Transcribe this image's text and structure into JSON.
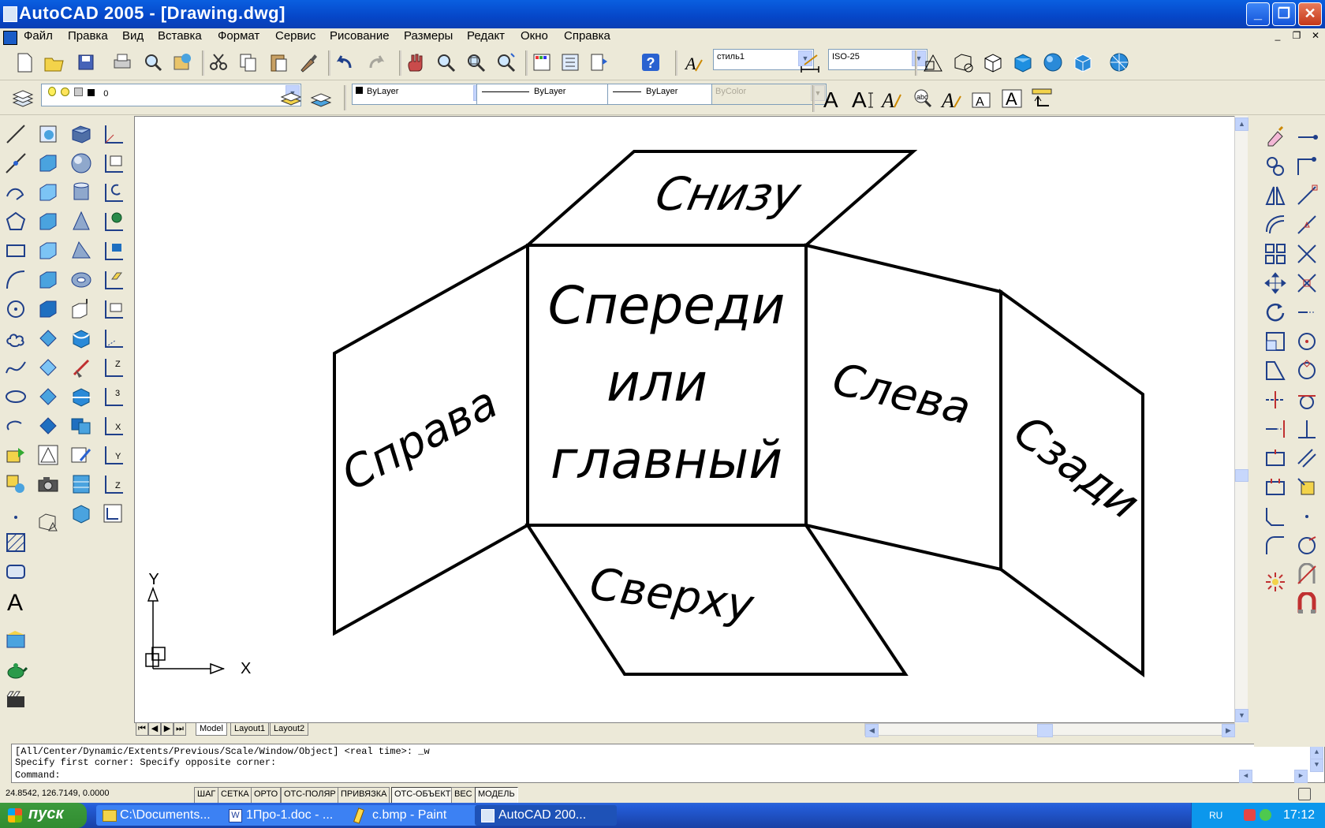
{
  "window": {
    "title": "AutoCAD 2005 - [Drawing.dwg]",
    "minimize": "_",
    "restore": "❐",
    "close": "✕"
  },
  "menu": {
    "items": [
      "Файл",
      "Правка",
      "Вид",
      "Вставка",
      "Формат",
      "Сервис",
      "Рисование",
      "Размеры",
      "Редакт",
      "Окно",
      "Справка"
    ],
    "mdi_min": "_",
    "mdi_restore": "❐",
    "mdi_close": "✕"
  },
  "toolbar": {
    "text_style": "стиль1",
    "dim_style": "ISO-25",
    "layer": "0",
    "color": "ByLayer",
    "linetype": "ByLayer",
    "lineweight": "ByLayer",
    "plotstyle": "ByColor"
  },
  "drawing": {
    "label_bottom": "Снизу",
    "label_front_1": "Спереди",
    "label_front_2": "или",
    "label_front_3": "главный",
    "label_right": "Справа",
    "label_left": "Слева",
    "label_back": "Сзади",
    "label_top": "Сверху",
    "ucs_y": "Y",
    "ucs_x": "X"
  },
  "tabs": {
    "nav_first": "⏮",
    "nav_prev": "◀",
    "nav_next": "▶",
    "nav_last": "⏭",
    "items": [
      "Model",
      "Layout1",
      "Layout2"
    ]
  },
  "command": {
    "line1": "[All/Center/Dynamic/Extents/Previous/Scale/Window/Object] <real time>: _w",
    "line2": "Specify first corner: Specify opposite corner:",
    "line3": "Command:"
  },
  "status": {
    "coords": "24.8542,  126.7149, 0.0000",
    "buttons": [
      "ШАГ",
      "СЕТКА",
      "ОРТО",
      "ОТС-ПОЛЯР",
      "ПРИВЯЗКА",
      "ОТС-ОБЪЕКТ",
      "ВЕС",
      "МОДЕЛЬ"
    ]
  },
  "taskbar": {
    "start": "пуск",
    "items": [
      "C:\\Documents...",
      "1Про-1.doc - ...",
      "c.bmp - Paint",
      "AutoCAD 200..."
    ],
    "lang": "RU",
    "clock": "17:12"
  }
}
